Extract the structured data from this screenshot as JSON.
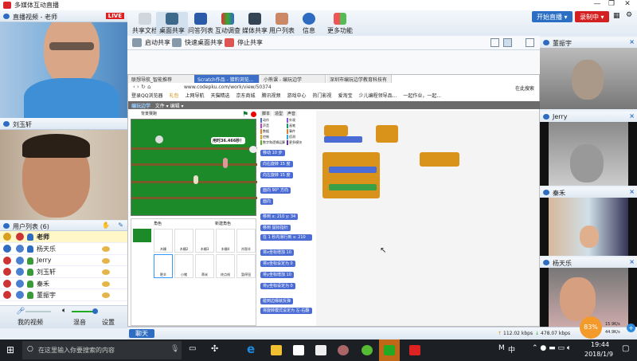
{
  "app": {
    "title": "多媒体互动直播"
  },
  "window_controls": {
    "minimize": "—",
    "restore": "❐",
    "close": "✕"
  },
  "left": {
    "teacher_panel": {
      "title": "直播视频 - 老师",
      "badge": "LIVE"
    },
    "student_panel": {
      "title": "刘玉轩"
    },
    "userlist": {
      "title": "用户列表 (6)",
      "users": [
        {
          "name": "老师",
          "chat": false,
          "highlight": true
        },
        {
          "name": "杨天乐",
          "chat": true
        },
        {
          "name": "Jerry",
          "chat": true
        },
        {
          "name": "刘玉轩",
          "chat": true
        },
        {
          "name": "秦禾",
          "chat": true
        },
        {
          "name": "董振宇",
          "chat": true
        }
      ]
    },
    "controls": {
      "my_video": "我的视频",
      "mix": "混音",
      "settings": "设置",
      "mic_level": 0,
      "speaker_level": 0.85
    }
  },
  "toolbar": {
    "items": [
      "共享文档",
      "桌面共享",
      "问答列表",
      "互动调查",
      "媒体共享",
      "用户列表",
      "信息",
      "更多功能"
    ],
    "active": "桌面共享",
    "start_live": "开始直播 ▾",
    "recording": "录制中 ▾"
  },
  "subbar": {
    "start": "启动共享",
    "quick": "快速桌面共享",
    "stop": "停止共享"
  },
  "browser": {
    "tabs": [
      "联想导航_智能推荐",
      "Scratch作品 - 猎豹浏览...",
      "小熊课 - 编玩边学",
      "深圳市编玩边学教育科技有限..."
    ],
    "url": "www.codepku.com/work/view/50374",
    "search": "在此搜索",
    "bookmarks": [
      "登录QQ浏览器",
      "礼包",
      "上网导航",
      "天猫精选",
      "京东商城",
      "腾讯视频",
      "游戏中心",
      "热门影视",
      "爱淘宝",
      "少儿编程领导品...",
      "一起作业，一起..."
    ],
    "scratch": {
      "brand": "编玩边学",
      "menus": [
        "文件 ▾",
        "编辑 ▾"
      ],
      "stage_title": "背景赛跑",
      "speech": "用时36.466秒！",
      "tabs": [
        "脚本",
        "造型",
        "声音"
      ],
      "categories": [
        "动作",
        "外观",
        "声音",
        "画笔",
        "数据",
        "事件",
        "控制",
        "侦测",
        "数字和逻辑运算",
        "更多模块"
      ],
      "sprites_label": "角色",
      "new_sprite": "新建角色",
      "sprites": [
        "木栅",
        "木栅2",
        "木栅3",
        "木栅4",
        "肖恩羊",
        "肥羊",
        "小猪",
        "蒂米",
        "终点线",
        "暂停钮"
      ],
      "blocks": [
        "移动 10 步",
        "向右旋转 15 度",
        "向左旋转 15 度",
        "面向 90° 方向",
        "面向",
        "移到 x: 210 y: 34",
        "移到 鼠标指针",
        "在 1 秒内滑行到 x: 210 y:",
        "将x坐标增加 10",
        "将x坐标设定为 0",
        "将y坐标增加 10",
        "将y坐标设定为 0",
        "碰到边缘就反弹",
        "将旋转模式设定为 左-右翻转"
      ]
    }
  },
  "right": {
    "panels": [
      {
        "name": "董振宇"
      },
      {
        "name": "Jerry"
      },
      {
        "name": "秦禾"
      },
      {
        "name": "杨天乐"
      }
    ]
  },
  "bottom": {
    "chat": "聊天",
    "upload": "112.02 kbps",
    "download": "478.07 kbps",
    "cpu": "83%",
    "up_speed": "15.9K/s",
    "down_speed": "44.9K/s"
  },
  "taskbar": {
    "search_placeholder": "在这里输入你要搜索的内容",
    "ime": "中",
    "time": "19:44",
    "date": "2018/1/9"
  }
}
